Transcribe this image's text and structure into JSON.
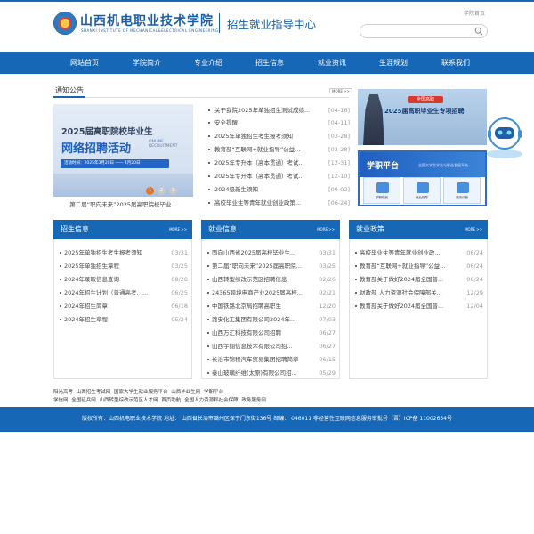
{
  "header": {
    "school_name": "山西机电职业技术学院",
    "school_name_en": "SHANXI INSTITUTE OF MECHANICAL&ELECTRICAL ENGINEERING",
    "center_name": "招生就业指导中心",
    "home_link": "学院首页",
    "search": {
      "placeholder": "",
      "value": ""
    }
  },
  "nav": [
    "网站首页",
    "学院简介",
    "专业介绍",
    "招生信息",
    "就业资讯",
    "生涯规划",
    "联系我们"
  ],
  "notice": {
    "title": "通知公告",
    "more": "MORE >>",
    "items": [
      {
        "title": "关于我院2025年单独招生测试成绩...",
        "date": "[04-16]"
      },
      {
        "title": "安全提醒",
        "date": "[04-11]"
      },
      {
        "title": "2025年单独招生考生报考须知",
        "date": "[03-28]"
      },
      {
        "title": "教育部“互联网+就业指导”公益...",
        "date": "[02-28]"
      },
      {
        "title": "2025年专升本（高本贯通）考试...",
        "date": "[12-31]"
      },
      {
        "title": "2025年专升本（高本贯通）考试...",
        "date": "[12-10]"
      },
      {
        "title": "2024级新生须知",
        "date": "[09-02]"
      },
      {
        "title": "高校毕业生等青年就业创业政策...",
        "date": "[06-24]"
      }
    ]
  },
  "banner": {
    "line1": "2025届高职院校毕业生",
    "line2": "网络招聘活动",
    "line3a": "ONLINE",
    "line3b": "RECRUITMENT",
    "date_text": "活动时间：2025年3月20日 —— 4月20日",
    "caption": "第二届“职向未来”2025届高职院校毕业...",
    "pages": [
      "1",
      "2",
      "3"
    ]
  },
  "promo": {
    "top_badge": "全国高职",
    "title": "2025届高职毕业生专项招聘",
    "platform_name": "学职平台",
    "platform_sub": "全国大学生学业与职业发展平台",
    "cards": [
      "学职规划",
      "就业指导",
      "简历诊断"
    ]
  },
  "panels": [
    {
      "title": "招生信息",
      "more": "MORE >>",
      "items": [
        {
          "title": "2025年单独招生考生报考须知",
          "date": "03/31"
        },
        {
          "title": "2025年单独招生章程",
          "date": "03/25"
        },
        {
          "title": "2024年录取信息查询",
          "date": "08/28"
        },
        {
          "title": "2024年招生计划（普通高考、...",
          "date": "06/25"
        },
        {
          "title": "2024年招生简章",
          "date": "06/18"
        },
        {
          "title": "2024年招生章程",
          "date": "05/24"
        }
      ]
    },
    {
      "title": "就业信息",
      "more": "MORE >>",
      "items": [
        {
          "title": "面向山西省2025届高校毕业生...",
          "date": "03/31"
        },
        {
          "title": "第二届“职向未来”2025届高职院...",
          "date": "03/25"
        },
        {
          "title": "山西转型综改示范区招聘信息",
          "date": "02/26"
        },
        {
          "title": "24365跨境电商产业2025届高校...",
          "date": "02/21"
        },
        {
          "title": "中国铁路北京局招聘高职生",
          "date": "12/20"
        },
        {
          "title": "潞安化工集团有限公司2024年...",
          "date": "07/03"
        },
        {
          "title": "山西万汇科技有限公司招聘",
          "date": "06/27"
        },
        {
          "title": "山西宇翔信息技术有限公司招...",
          "date": "06/27"
        },
        {
          "title": "长治市锦程汽车贸易集团招聘简章",
          "date": "06/15"
        },
        {
          "title": "泰山玻璃纤维(太原)有限公司招...",
          "date": "05/29"
        }
      ]
    },
    {
      "title": "就业政策",
      "more": "MORE >>",
      "items": [
        {
          "title": "高校毕业生等青年就业创业政...",
          "date": "06/24"
        },
        {
          "title": "教育部“互联网+就业指导”公益...",
          "date": "06/24"
        },
        {
          "title": "教育部关于做好2024届全国普...",
          "date": "06/24"
        },
        {
          "title": "财政部 人力资源社会保障部关...",
          "date": "12/29"
        },
        {
          "title": "教育部关于做好2024届全国普...",
          "date": "12/04"
        }
      ]
    }
  ],
  "links": [
    "阳光高考",
    "山西招生考试网",
    "国家大学生就业服务平台",
    "山西毕业生网",
    "学职平台",
    "学信网",
    "全国征兵网",
    "山西转型综改示范区人才网",
    "首页助航",
    "全国人力资源和社会保障",
    "政务服务网"
  ],
  "footer": {
    "text": "版权所有：山西机电职业技术学院  地址：  山西省长治市潞州区保宁门东街136号  邮编：  046011  非经营性互联网信息服务审批号（晋）ICP备 11002654号"
  },
  "colors": {
    "primary": "#1667b5",
    "accent_red": "#d8392f"
  }
}
